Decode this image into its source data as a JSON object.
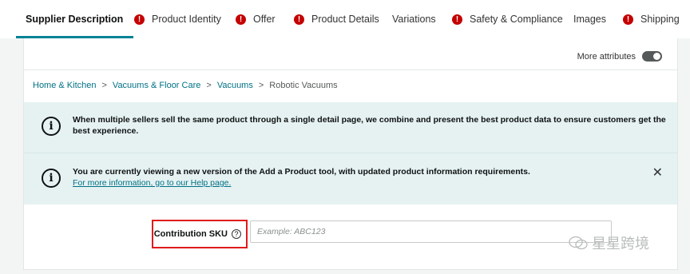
{
  "tabs": [
    {
      "label": "Supplier Description",
      "active": true,
      "error": false
    },
    {
      "label": "Product Identity",
      "active": false,
      "error": true
    },
    {
      "label": "Offer",
      "active": false,
      "error": true
    },
    {
      "label": "Product Details",
      "active": false,
      "error": true
    },
    {
      "label": "Variations",
      "active": false,
      "error": false
    },
    {
      "label": "Safety & Compliance",
      "active": false,
      "error": true
    },
    {
      "label": "Images",
      "active": false,
      "error": false
    },
    {
      "label": "Shipping",
      "active": false,
      "error": true
    }
  ],
  "more_attributes": {
    "label": "More attributes",
    "enabled": false
  },
  "breadcrumb": [
    "Home & Kitchen",
    "Vacuums & Floor Care",
    "Vacuums",
    "Robotic Vacuums"
  ],
  "alerts": {
    "combine": {
      "message": "When multiple sellers sell the same product through a single detail page, we combine and present the best product data to ensure customers get the best experience."
    },
    "new_version": {
      "message": "You are currently viewing a new version of the Add a Product tool, with updated product information requirements.",
      "link": "For more information, go to our Help page."
    }
  },
  "contribution_sku": {
    "label": "Contribution SKU",
    "placeholder": "Example: ABC123",
    "value": ""
  },
  "watermark": {
    "text": "星星跨境"
  },
  "colors": {
    "accent": "#008296",
    "error": "#c40000",
    "alert_bg": "#e6f2f2",
    "link": "#007185",
    "highlight_border": "#e01b1b"
  }
}
